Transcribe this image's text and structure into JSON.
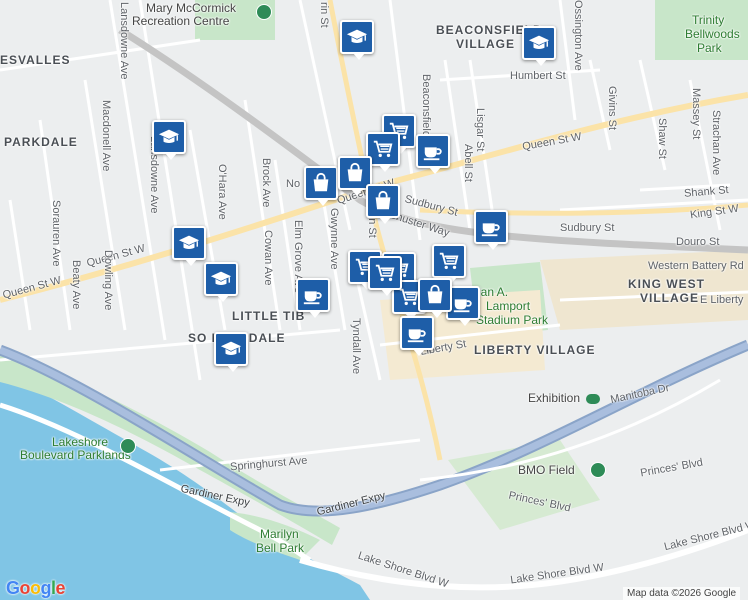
{
  "map": {
    "colors": {
      "background": "#eceeef",
      "water": "#80c5e5",
      "park": "#c8e6c9",
      "highway": "#f2cf73",
      "arterial": "#ffffff",
      "rail": "#c4c4c4",
      "marker_fill": "#1e5ea8",
      "marker_border": "#ffffff"
    },
    "areas": [
      "BEACONSFIELD VILLAGE",
      "PARKDALE",
      "ESVALLES",
      "LITTLE TIBET",
      "SOUTH PARKDALE",
      "LIBERTY VILLAGE",
      "KING WEST VILLAGE"
    ],
    "parks": [
      "Trinity Bellwoods Park",
      "Lakeshore Boulevard Parklands",
      "Marilyn Bell Park",
      "Lamport Stadium Park"
    ],
    "pois": [
      "Mary McCormick Recreation Centre",
      "BMO Field",
      "Exhibition"
    ],
    "streets": [
      "Queen St W",
      "King St W",
      "Springhurst Ave",
      "Lake Shore Blvd W",
      "Gardiner Expy",
      "Humbert St",
      "Sudbury St",
      "Shank St",
      "Douro St",
      "Western Battery Rd",
      "Liberty St",
      "Manitoba Dr",
      "Princes' Blvd",
      "Dufferin St",
      "Lansdowne Ave",
      "Macdonell Ave",
      "Sorauren Ave",
      "Beaty Ave",
      "Dowling Ave",
      "O'Hara Ave",
      "Brock Ave",
      "Cowan Ave",
      "Elm Grove Ave",
      "Gwynne Ave",
      "Tyndall Ave",
      "Beaconsfield Ave",
      "Lisgar St",
      "Abell St",
      "Givins St",
      "Shaw St",
      "Strachan Ave",
      "Massey St",
      "Ossington Ave",
      "Shuster Way",
      "Noble St",
      "E Liberty St"
    ],
    "labels": {
      "mary_mccormick": "Mary McCormick",
      "recreation_centre": "Recreation Centre",
      "trinity": "Trinity",
      "bellwoods": "Bellwoods",
      "park": "Park",
      "beaconsfield": "BEACONSFIELD",
      "village": "VILLAGE",
      "esvalles": "ESVALLES",
      "parkdale": "PARKDALE",
      "little_tibet": "LITTLE TIB",
      "south_parkdale": "SO PARKDALE",
      "liberty_village": "LIBERTY VILLAGE",
      "king_west": "KING WEST",
      "king_west_village": "VILLAGE",
      "lakeshore": "Lakeshore",
      "boulevard_parklands": "Boulevard Parklands",
      "marilyn": "Marilyn",
      "bell_park": "Bell Park",
      "lamport1": "lan A.",
      "lamport2": "Lamport",
      "lamport3": "Stadium Park",
      "bmo": "BMO Field",
      "exhibition": "Exhibition",
      "queen_a": "Queen St W",
      "queen_b": "Queen St W",
      "queen_c": "Queen St W",
      "queen_d": "Queen St W",
      "king": "King St W",
      "springhurst": "Springhurst Ave",
      "lakeshore_a": "Lake Shore Blvd W",
      "lakeshore_b": "Lake Shore Blvd W",
      "lakeshore_c": "Lake Shore Blvd W",
      "gardiner_a": "Gardiner Expy",
      "gardiner_b": "Gardiner Expy",
      "humbert": "Humbert St",
      "sudbury_a": "Sudbury St",
      "sudbury_b": "Sudbury St",
      "shank": "Shank St",
      "douro": "Douro St",
      "battery": "Western Battery Rd",
      "liberty": "Liberty St",
      "manitoba": "Manitoba Dr",
      "princes_a": "Princes' Blvd",
      "princes_b": "Princes' Blvd",
      "dufferin": "Dufferin St",
      "lansdowne_a": "Lansdowne Ave",
      "lansdowne_b": "Lansdowne Ave",
      "macdonell": "Macdonell Ave",
      "sorauren": "Sorauren Ave",
      "beaty": "Beaty Ave",
      "dowling": "Dowling Ave",
      "ohara": "O'Hara Ave",
      "brock": "Brock Ave",
      "cowan": "Cowan Ave",
      "elmgrove": "Elm Grove Ave",
      "gwynne": "Gwynne Ave",
      "tyndall": "Tyndall Ave",
      "beaconsfield_ave": "Beaconsfield Ave",
      "lisgar": "Lisgar St",
      "abell": "Abell St",
      "givins": "Givins St",
      "shaw": "Shaw St",
      "strachan": "Strachan Ave",
      "massey": "Massey St",
      "ossington": "Ossington Ave",
      "shuster": "Shuster Way",
      "noble": "No",
      "eliberty": "E Liberty",
      "dufferin_top": "rin St"
    }
  },
  "markers": [
    {
      "type": "cart"
    },
    {
      "type": "cart"
    },
    {
      "type": "cart"
    },
    {
      "type": "cart"
    },
    {
      "type": "cart"
    },
    {
      "type": "cart"
    },
    {
      "type": "cart"
    },
    {
      "type": "coffee"
    },
    {
      "type": "coffee"
    },
    {
      "type": "coffee"
    },
    {
      "type": "coffee"
    },
    {
      "type": "coffee"
    },
    {
      "type": "bag"
    },
    {
      "type": "bag"
    },
    {
      "type": "bag"
    },
    {
      "type": "bag"
    },
    {
      "type": "school"
    },
    {
      "type": "school"
    },
    {
      "type": "school"
    },
    {
      "type": "school"
    },
    {
      "type": "school"
    },
    {
      "type": "school"
    }
  ],
  "attribution": {
    "google": "Google",
    "map_data": "Map data ©2026 Google"
  }
}
